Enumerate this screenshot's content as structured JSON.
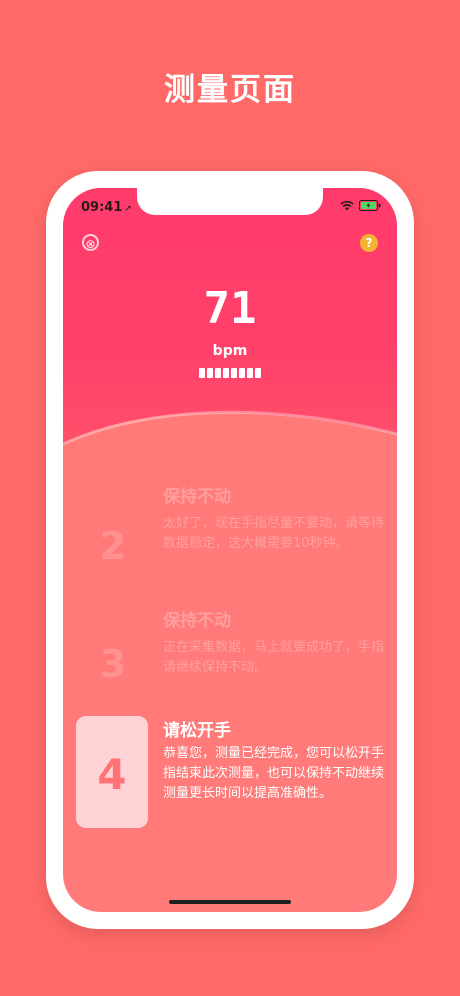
{
  "page": {
    "heading": "测量页面"
  },
  "status_bar": {
    "time": "09:41",
    "location_arrow": "➚",
    "icons": [
      "wifi-icon",
      "battery-icon"
    ]
  },
  "header": {
    "close_icon": "⊗",
    "help_icon": "?",
    "bpm_value": "71",
    "bpm_unit": "bpm",
    "progress_segments": 8
  },
  "steps": [
    {
      "number": "2",
      "title": "保持不动",
      "description": "太好了，现在手指尽量不要动，请等待数据稳定，这大概需要10秒钟。",
      "state": "done"
    },
    {
      "number": "3",
      "title": "保持不动",
      "description": "正在采集数据，马上就要成功了，手指请继续保持不动。",
      "state": "done"
    },
    {
      "number": "4",
      "title": "请松开手",
      "description": "恭喜您，测量已经完成，您可以松开手指结束此次测量，也可以保持不动继续测量更长时间以提高准确性。",
      "state": "active"
    }
  ],
  "colors": {
    "background": "#ff6a68",
    "header": "#ff3b6b",
    "body": "#ff7a78",
    "active_card": "#ffd3d5",
    "help_button": "#f3b432"
  }
}
